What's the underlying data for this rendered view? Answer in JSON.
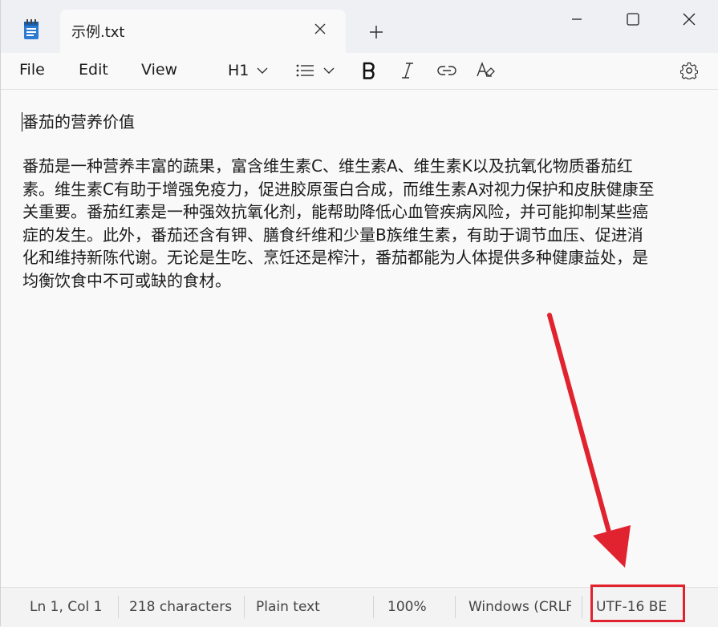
{
  "tab": {
    "title": "示例.txt"
  },
  "menu": {
    "file": "File",
    "edit": "Edit",
    "view": "View"
  },
  "toolbar": {
    "heading": "H1"
  },
  "document": {
    "heading": "番茄的营养价值",
    "lines": [
      "番茄是一种营养丰富的蔬果，富含维生素C、维生素A、维生素K以及抗氧化物质番茄红",
      "素。维生素C有助于增强免疫力，促进胶原蛋白合成，而维生素A对视力保护和皮肤健康至",
      "关重要。番茄红素是一种强效抗氧化剂，能帮助降低心血管疾病风险，并可能抑制某些癌",
      "症的发生。此外，番茄还含有钾、膳食纤维和少量B族维生素，有助于调节血压、促进消",
      "化和维持新陈代谢。无论是生吃、烹饪还是榨汁，番茄都能为人体提供多种健康益处，是",
      "均衡饮食中不可或缺的食材。"
    ]
  },
  "status": {
    "position": "Ln 1, Col 1",
    "characters": "218 characters",
    "format": "Plain text",
    "zoom": "100%",
    "line_ending": "Windows (CRLF)",
    "encoding": "UTF-16 BE"
  },
  "colors": {
    "annotation": "#e0232e",
    "accent": "#0067c0"
  },
  "icons": [
    "notepad-icon",
    "close-icon",
    "plus-icon",
    "minimize-icon",
    "maximize-icon",
    "window-close-icon",
    "chevron-down-icon",
    "list-icon",
    "bold-icon",
    "italic-icon",
    "link-icon",
    "clear-format-icon",
    "gear-icon"
  ]
}
